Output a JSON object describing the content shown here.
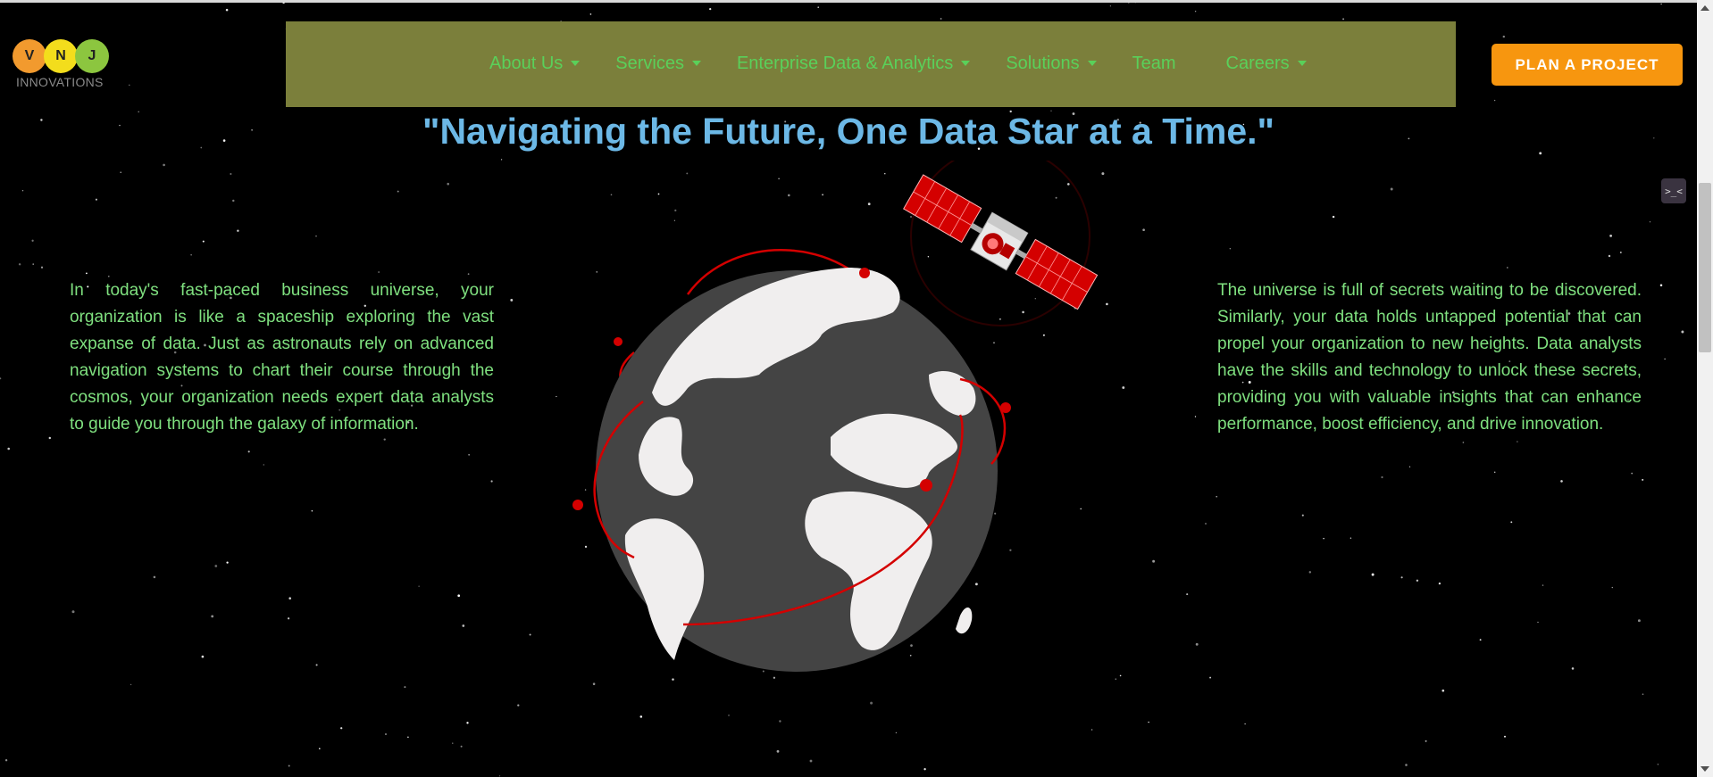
{
  "logo": {
    "letters": [
      "V",
      "N",
      "J"
    ],
    "wordmark": "INNOVATIONS"
  },
  "nav": {
    "items": [
      {
        "label": "About Us",
        "dropdown": true
      },
      {
        "label": "Services",
        "dropdown": true
      },
      {
        "label": "Enterprise Data & Analytics",
        "dropdown": true
      },
      {
        "label": "Solutions",
        "dropdown": true
      },
      {
        "label": "Team",
        "dropdown": false
      },
      {
        "label": "Careers",
        "dropdown": true
      }
    ],
    "cta_label": "PLAN A PROJECT"
  },
  "hero": {
    "headline": "\"Navigating the Future, One Data Star at a Time.\"",
    "left_paragraph": "In today's fast-paced business universe, your organization is like a spaceship exploring the vast expanse of data. Just as astronauts rely on advanced navigation systems to chart their course through the cosmos, your organization needs expert data analysts to guide you through the galaxy of information.",
    "right_paragraph": "The universe is full of secrets waiting to be discovered. Similarly, your data holds untapped potential that can propel your organization to new heights. Data analysts have the skills and technology to unlock these secrets, providing you with valuable insights that can enhance performance, boost efficiency, and drive innovation."
  },
  "side_widget": {
    "glyph": ">_<"
  },
  "colors": {
    "background": "#000000",
    "navbar": "#7b7f3b",
    "nav_text": "#5ad05a",
    "cta": "#f7960f",
    "headline": "#6cb8e6",
    "body_text": "#7fe07f",
    "orbit_red": "#d40000",
    "globe_land": "#f0eeee",
    "globe_ocean": "#444444"
  },
  "icons": {
    "globe": "globe-illustration",
    "satellite": "satellite-illustration",
    "caret": "chevron-down-icon"
  }
}
